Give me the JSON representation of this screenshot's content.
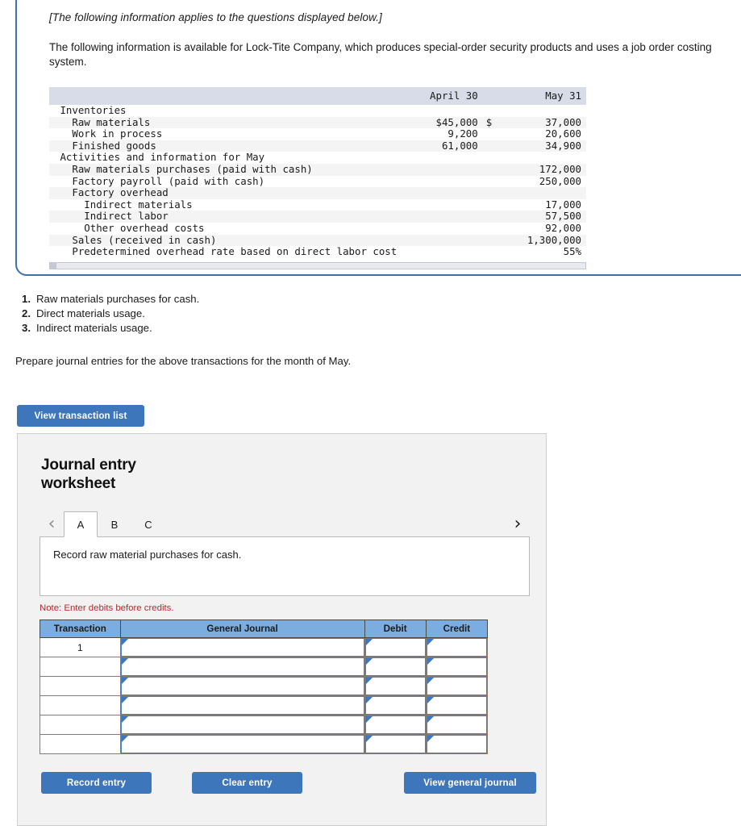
{
  "info_panel": {
    "applies_note": "[The following information applies to the questions displayed below.]",
    "intro": "The following information is available for Lock-Tite Company, which produces special-order security products and uses a job order costing system.",
    "table": {
      "columns": [
        "",
        "April 30",
        "May 31"
      ],
      "rows": [
        {
          "label": "Inventories",
          "indent": 0,
          "april": "",
          "cur": "",
          "may": "",
          "stripe": false
        },
        {
          "label": "Raw materials",
          "indent": 1,
          "april": "$45,000",
          "cur": "$",
          "may": "37,000",
          "stripe": true
        },
        {
          "label": "Work in process",
          "indent": 1,
          "april": "9,200",
          "cur": "",
          "may": "20,600",
          "stripe": false
        },
        {
          "label": "Finished goods",
          "indent": 1,
          "april": "61,000",
          "cur": "",
          "may": "34,900",
          "stripe": true
        },
        {
          "label": "Activities and information for May",
          "indent": 0,
          "april": "",
          "cur": "",
          "may": "",
          "stripe": false
        },
        {
          "label": "Raw materials purchases (paid with cash)",
          "indent": 1,
          "april": "",
          "cur": "",
          "may": "172,000",
          "stripe": true
        },
        {
          "label": "Factory payroll (paid with cash)",
          "indent": 1,
          "april": "",
          "cur": "",
          "may": "250,000",
          "stripe": false
        },
        {
          "label": "Factory overhead",
          "indent": 1,
          "april": "",
          "cur": "",
          "may": "",
          "stripe": true
        },
        {
          "label": "Indirect materials",
          "indent": 2,
          "april": "",
          "cur": "",
          "may": "17,000",
          "stripe": false
        },
        {
          "label": "Indirect labor",
          "indent": 2,
          "april": "",
          "cur": "",
          "may": "57,500",
          "stripe": true
        },
        {
          "label": "Other overhead costs",
          "indent": 2,
          "april": "",
          "cur": "",
          "may": "92,000",
          "stripe": false
        },
        {
          "label": "Sales (received in cash)",
          "indent": 1,
          "april": "",
          "cur": "",
          "may": "1,300,000",
          "stripe": true
        },
        {
          "label": "Predetermined overhead rate based on direct labor cost",
          "indent": 1,
          "april": "",
          "cur": "",
          "may": "55%",
          "stripe": false
        }
      ]
    }
  },
  "requirements": [
    {
      "num": "1.",
      "text": "Raw materials purchases for cash."
    },
    {
      "num": "2.",
      "text": "Direct materials usage."
    },
    {
      "num": "3.",
      "text": "Indirect materials usage."
    }
  ],
  "prepare_instruction": "Prepare journal entries for the above transactions for the month of May.",
  "view_transaction_list_label": "View transaction list",
  "worksheet": {
    "title": "Journal entry worksheet",
    "prev_icon": "chevron-left-icon",
    "next_icon": "chevron-right-icon",
    "tabs": [
      {
        "label": "A",
        "active": true
      },
      {
        "label": "B",
        "active": false
      },
      {
        "label": "C",
        "active": false
      }
    ],
    "description": "Record raw material purchases for cash.",
    "note": "Note: Enter debits before credits.",
    "journal_table": {
      "headers": [
        "Transaction",
        "General Journal",
        "Debit",
        "Credit"
      ],
      "rows": [
        {
          "transaction": "1",
          "general_journal": "",
          "debit": "",
          "credit": ""
        },
        {
          "transaction": "",
          "general_journal": "",
          "debit": "",
          "credit": ""
        },
        {
          "transaction": "",
          "general_journal": "",
          "debit": "",
          "credit": ""
        },
        {
          "transaction": "",
          "general_journal": "",
          "debit": "",
          "credit": ""
        },
        {
          "transaction": "",
          "general_journal": "",
          "debit": "",
          "credit": ""
        },
        {
          "transaction": "",
          "general_journal": "",
          "debit": "",
          "credit": ""
        }
      ]
    },
    "buttons": {
      "record": "Record entry",
      "clear": "Clear entry",
      "view_general_journal": "View general journal"
    }
  },
  "colors": {
    "primary_blue": "#3d76ba",
    "panel_border_blue": "#3f6fae",
    "table_header_blue": "#7cade0",
    "fin_header_gray": "#d7dce8",
    "note_red": "#b4292f"
  }
}
